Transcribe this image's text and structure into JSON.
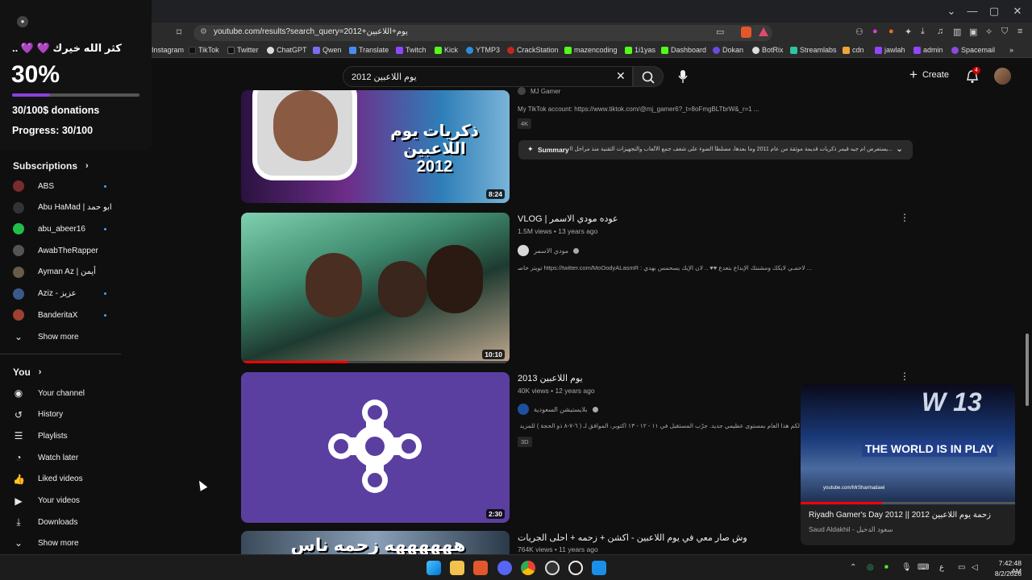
{
  "browser": {
    "url": "youtube.com/results?search_query=2012+يوم+اللاعبين",
    "bookmarks": [
      "Instagram",
      "TikTok",
      "Twitter",
      "ChatGPT",
      "Qwen",
      "Translate",
      "Twitch",
      "Kick",
      "YTMP3",
      "CrackStation",
      "mazencoding",
      "1i1yas",
      "Dashboard",
      "Dokan",
      "BotRix",
      "Streamlabs",
      "cdn",
      "jawlah",
      "admin",
      "Spacemail"
    ]
  },
  "donation": {
    "message": "كثر الله خيرك 💜 💜 ..",
    "percent_text": "30%",
    "progress_fraction": 0.3,
    "donations_text": "30/100$ donations",
    "progress_text": "Progress: 30/100",
    "accent": "#8d3ee0"
  },
  "sidebar": {
    "subscriptions_title": "Subscriptions",
    "subscriptions": [
      {
        "name": "ABS",
        "new": true,
        "color": "#7a2b2b"
      },
      {
        "name": "Abu HaMad | ابو حمد",
        "new": false,
        "color": "#333"
      },
      {
        "name": "abu_abeer16",
        "new": true,
        "color": "#1fbf4a"
      },
      {
        "name": "AwabTheRapper",
        "new": false,
        "color": "#555"
      },
      {
        "name": "Ayman Az | أيمن",
        "new": false,
        "color": "#6a5a4a"
      },
      {
        "name": "Aziz - عزيز",
        "new": true,
        "color": "#3a5a8a"
      },
      {
        "name": "BanderitaX",
        "new": true,
        "color": "#a04030"
      }
    ],
    "show_more": "Show more",
    "you_title": "You",
    "you_items": [
      {
        "label": "Your channel",
        "icon": "person-icon"
      },
      {
        "label": "History",
        "icon": "history-icon"
      },
      {
        "label": "Playlists",
        "icon": "playlists-icon"
      },
      {
        "label": "Watch later",
        "icon": "clock-icon"
      },
      {
        "label": "Liked videos",
        "icon": "thumbs-up-icon"
      },
      {
        "label": "Your videos",
        "icon": "video-icon"
      },
      {
        "label": "Downloads",
        "icon": "download-icon"
      }
    ],
    "show_more_2": "Show more"
  },
  "masthead": {
    "search_value": "يوم اللاعبين 2012",
    "create_label": "Create",
    "notification_count": "4"
  },
  "results": [
    {
      "title": "",
      "channel": "MJ Gamer",
      "description": "My TikTok account: https://www.tiktok.com/@mj_gamer6?_t=8oFmgBLTbrW&_r=1 ...",
      "badge": "4K",
      "duration": "8:24",
      "summary_label": "Summary",
      "summary_text": "...يستعرض ام جيه قيمر ذكريات قديمة موثقة من عام 2011 وما بعدها، مسلطاً الضوء على شغف جمع الألعاب والتجهيزات التقنية منذ مراحل الدراسة الثانوية",
      "thumb_text": "ذكريات يوم اللاعبين 2012"
    },
    {
      "title": "VLOG | عوده مودي الاسمر",
      "meta": "1.5M views • 13 years ago",
      "channel": "مودي الاسمر",
      "description": "... لاحمـي لايكك ومشنتك الإبداع بتعدع ♥♥ .. لان الإيك يسحمس بهدي : https://twitter.com/MoOodyALasmR تويتر خاصي ♥♥",
      "duration": "10:10"
    },
    {
      "title": "يوم اللاعبين 2013",
      "meta": "40K views • 12 years ago",
      "channel": "بلايستيشن السعودية",
      "description": "لكم هذا العام بمستوى عظيمي جديد. جرّب المستقبل في ١١ - ١٢ - ١٣ اكتوبر، الموافق لـ ( ٦-٧-٨ ذو الحجة ) للمزيد من ... يوم اللاعبين",
      "badge": "3D",
      "duration": "2:30"
    },
    {
      "title": "وش صار معي في يوم اللاعبين - اكشن + زحمه + احلى الجريات",
      "meta": "764K views • 11 years ago",
      "thumb_text": "ههههههه زحمه ناس"
    }
  ],
  "miniplayer": {
    "title": "Riyadh Gamer's Day 2012 || زحمة يوم اللاعبين 2012",
    "channel": "Saud Aldakhil - سعود الدخيل",
    "overlay_big": "W 13",
    "overlay_banner": "THE WORLD IS IN PLAY",
    "watermark": "youtube.com/MrSharmadawi"
  },
  "taskbar": {
    "time": "7:42:48 AM",
    "date": "8/2/2026",
    "lang": "ع"
  }
}
